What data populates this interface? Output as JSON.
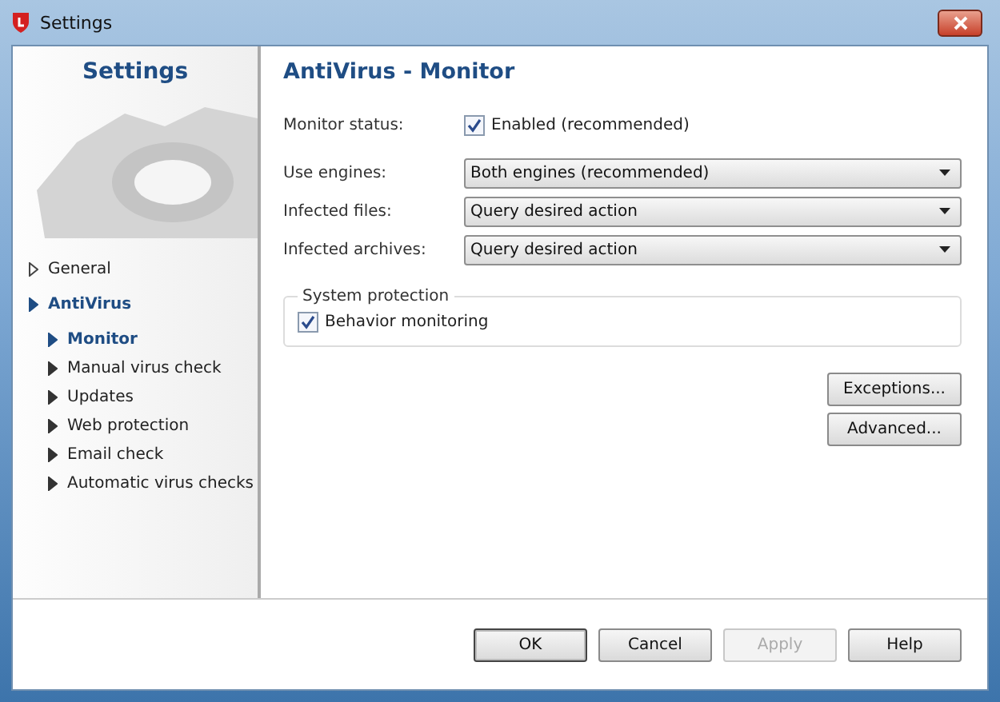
{
  "window": {
    "title": "Settings"
  },
  "sidebar": {
    "title": "Settings",
    "items": [
      {
        "label": "General",
        "expanded": false
      },
      {
        "label": "AntiVirus",
        "expanded": true,
        "children": [
          {
            "label": "Monitor",
            "selected": true
          },
          {
            "label": "Manual virus check",
            "selected": false
          },
          {
            "label": "Updates",
            "selected": false
          },
          {
            "label": "Web protection",
            "selected": false
          },
          {
            "label": "Email check",
            "selected": false
          },
          {
            "label": "Automatic virus checks",
            "selected": false
          }
        ]
      }
    ]
  },
  "page": {
    "title": "AntiVirus - Monitor",
    "monitor_status": {
      "label": "Monitor status:",
      "checkbox": "Enabled (recommended)",
      "checked": true
    },
    "dropdowns": [
      {
        "label": "Use engines:",
        "value": "Both engines (recommended)"
      },
      {
        "label": "Infected files:",
        "value": "Query desired action"
      },
      {
        "label": "Infected archives:",
        "value": "Query desired action"
      }
    ],
    "group": {
      "title": "System protection",
      "checkbox": "Behavior monitoring",
      "checked": true
    },
    "side_buttons": [
      "Exceptions...",
      "Advanced..."
    ]
  },
  "buttons": [
    {
      "label": "OK",
      "default": true,
      "disabled": false
    },
    {
      "label": "Cancel",
      "default": false,
      "disabled": false
    },
    {
      "label": "Apply",
      "default": false,
      "disabled": true
    },
    {
      "label": "Help",
      "default": false,
      "disabled": false
    }
  ]
}
